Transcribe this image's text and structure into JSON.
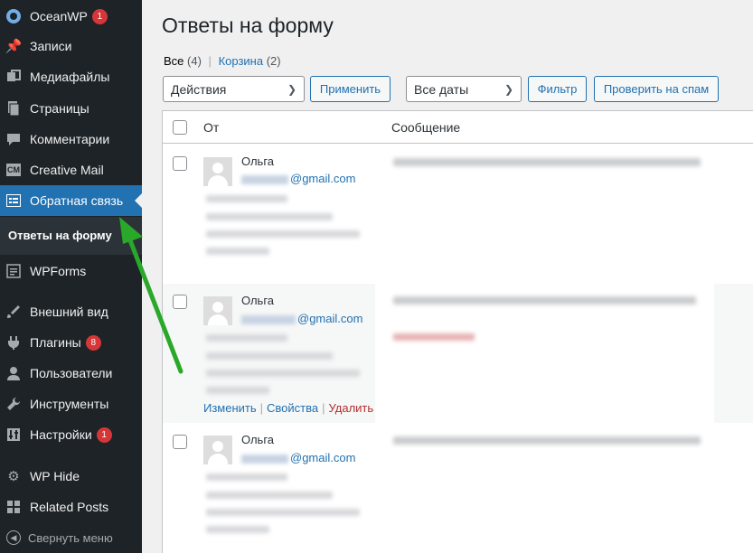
{
  "sidebar": {
    "items": [
      {
        "label": "OceanWP",
        "icon": "oceanwp-icon",
        "badge": "1"
      },
      {
        "label": "Записи",
        "icon": "pin-icon"
      },
      {
        "label": "Медиафайлы",
        "icon": "media-icon"
      },
      {
        "label": "Страницы",
        "icon": "page-icon"
      },
      {
        "label": "Комментарии",
        "icon": "comment-icon"
      },
      {
        "label": "Creative Mail",
        "icon": "cm-icon"
      },
      {
        "label": "Обратная связь",
        "icon": "feedback-icon"
      },
      {
        "label": "WPForms",
        "icon": "wpforms-icon"
      },
      {
        "label": "Внешний вид",
        "icon": "brush-icon"
      },
      {
        "label": "Плагины",
        "icon": "plugin-icon",
        "badge": "8"
      },
      {
        "label": "Пользователи",
        "icon": "user-icon"
      },
      {
        "label": "Инструменты",
        "icon": "wrench-icon"
      },
      {
        "label": "Настройки",
        "icon": "settings-icon",
        "badge": "1"
      },
      {
        "label": "WP Hide",
        "icon": "gear-icon"
      },
      {
        "label": "Related Posts",
        "icon": "grid-icon"
      },
      {
        "label": "Свернуть меню",
        "icon": "collapse-icon"
      }
    ],
    "submenu_label": "Ответы на форму",
    "cm_text": "CM"
  },
  "page": {
    "title": "Ответы на форму",
    "filter_all": "Все",
    "filter_all_count": "(4)",
    "filter_trash": "Корзина",
    "filter_trash_count": "(2)",
    "actions_select": "Действия",
    "apply_button": "Применить",
    "dates_select": "Все даты",
    "filter_button": "Фильтр",
    "spam_button": "Проверить на спам"
  },
  "table": {
    "col_from": "От",
    "col_message": "Сообщение",
    "rows": [
      {
        "name": "Ольга",
        "email_suffix": "@gmail.com"
      },
      {
        "name": "Ольга",
        "email_suffix": "@gmail.com"
      },
      {
        "name": "Ольга",
        "email_suffix": "@gmail.com"
      }
    ],
    "row_actions": {
      "edit": "Изменить",
      "props": "Свойства",
      "delete": "Удалить"
    }
  },
  "colors": {
    "sidebar_bg": "#1d2327",
    "accent": "#2271b1",
    "badge": "#d63638",
    "arrow": "#2aa82a"
  }
}
